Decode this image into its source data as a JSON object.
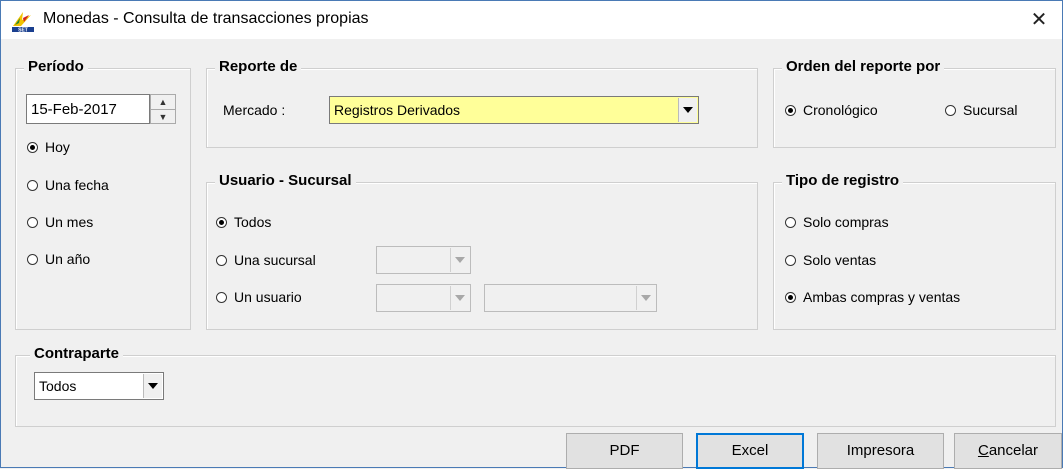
{
  "window": {
    "title": "Monedas - Consulta de transacciones propias",
    "close_glyph": "✕"
  },
  "periodo": {
    "legend": "Período",
    "date_value": "15-Feb-2017",
    "options": [
      {
        "label": "Hoy",
        "checked": true
      },
      {
        "label": "Una fecha",
        "checked": false
      },
      {
        "label": "Un mes",
        "checked": false
      },
      {
        "label": "Un año",
        "checked": false
      }
    ]
  },
  "reporte": {
    "legend": "Reporte de",
    "mercado_label": "Mercado :",
    "mercado_value": "Registros Derivados",
    "mercado_bg": "#ffff99"
  },
  "usuario_sucursal": {
    "legend": "Usuario - Sucursal",
    "options": [
      {
        "label": "Todos",
        "checked": true
      },
      {
        "label": "Una sucursal",
        "checked": false
      },
      {
        "label": "Un usuario",
        "checked": false
      }
    ]
  },
  "orden": {
    "legend": "Orden del reporte por",
    "options": [
      {
        "label": "Cronológico",
        "checked": true
      },
      {
        "label": "Sucursal",
        "checked": false
      }
    ]
  },
  "tipo_registro": {
    "legend": "Tipo de registro",
    "options": [
      {
        "label": "Solo compras",
        "checked": false
      },
      {
        "label": "Solo ventas",
        "checked": false
      },
      {
        "label": "Ambas compras y ventas",
        "checked": true
      }
    ]
  },
  "contraparte": {
    "legend": "Contraparte",
    "value": "Todos"
  },
  "buttons": {
    "pdf": "PDF",
    "excel": "Excel",
    "impresora": "Impresora",
    "cancelar_first": "C",
    "cancelar_rest": "ancelar"
  },
  "colors": {
    "window_border": "#4a7ab5",
    "default_button_border": "#0078d7",
    "face": "#f0f0f0"
  }
}
